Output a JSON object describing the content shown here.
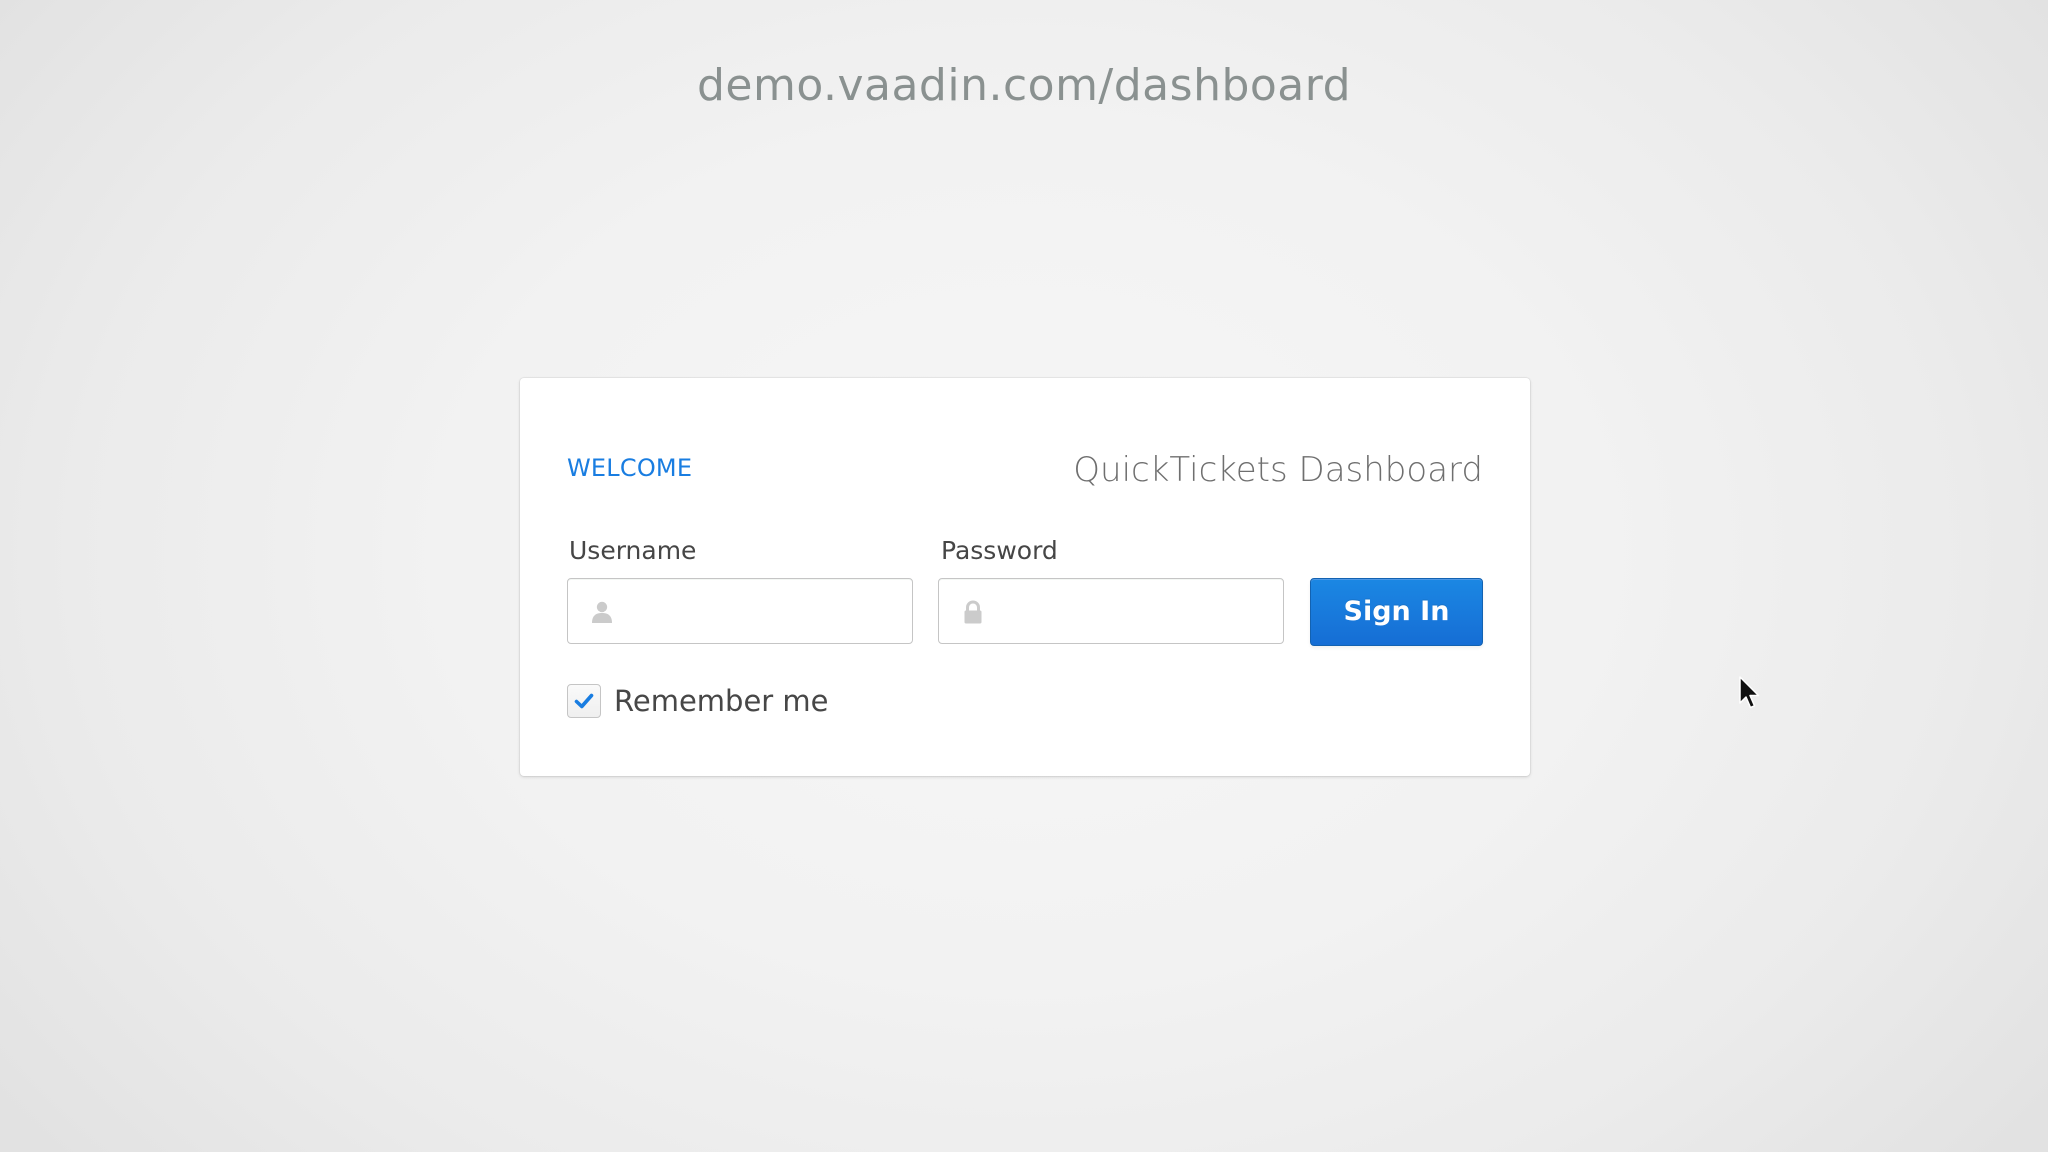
{
  "caption": {
    "url": "demo.vaadin.com/dashboard"
  },
  "login": {
    "welcome_text": "WELCOME",
    "app_name": "QuickTickets Dashboard",
    "username": {
      "label": "Username",
      "value": "",
      "icon": "user-icon"
    },
    "password": {
      "label": "Password",
      "value": "",
      "icon": "lock-icon"
    },
    "sign_in_label": "Sign In",
    "remember_me": {
      "label": "Remember me",
      "checked": true,
      "icon": "checkmark-icon"
    }
  },
  "colors": {
    "accent": "#197de1",
    "button_top": "#1b87e3",
    "button_bottom": "#166ed5",
    "text": "#474747",
    "muted_text": "#6f6f6f",
    "caption_text": "#8a9190",
    "border": "#c5c5c5",
    "background": "#f2f2f2"
  }
}
